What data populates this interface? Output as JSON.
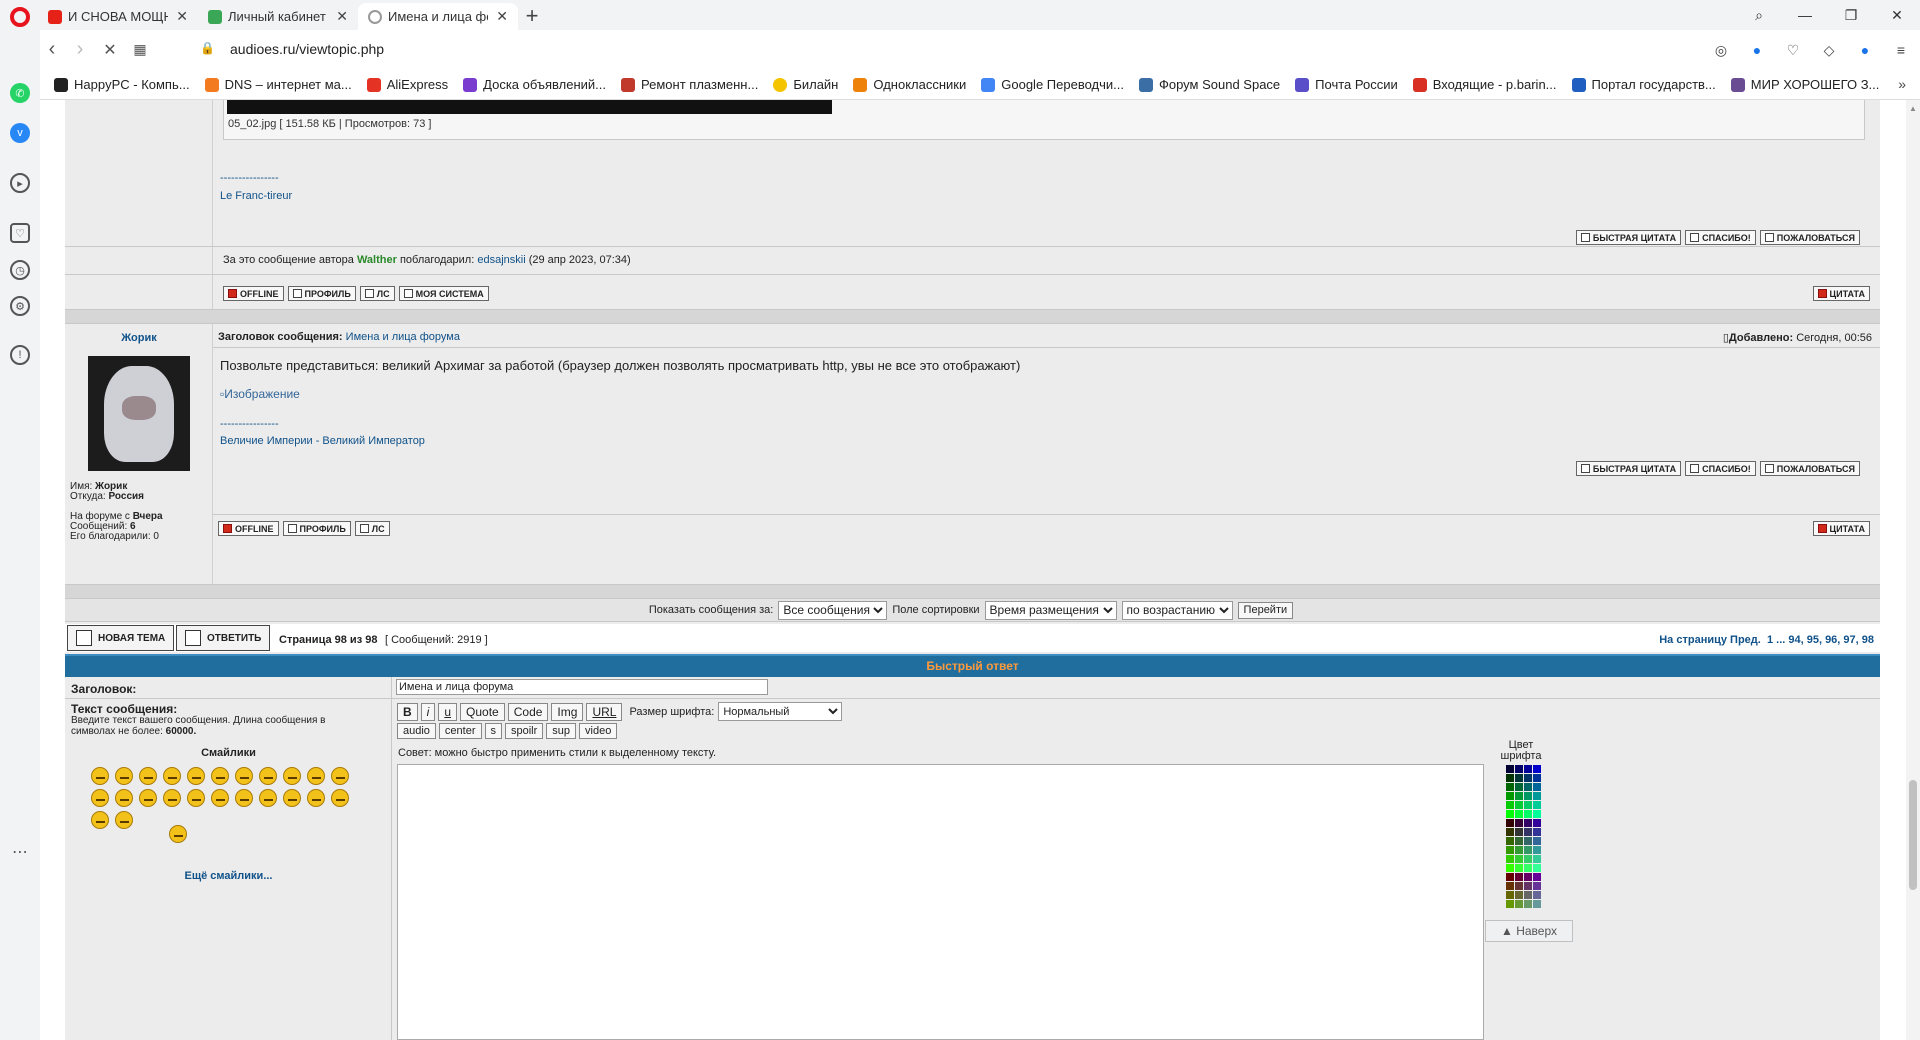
{
  "tabs": [
    {
      "label": "И СНОВА МОЩНЫЙ П...",
      "color": "#e62117"
    },
    {
      "label": "Личный кабинет - Мои о...",
      "color": "#3aa757"
    },
    {
      "label": "Имена и лица форума Фо...",
      "color": "#cfcfcf"
    }
  ],
  "address": {
    "url": "audioes.ru/viewtopic.php"
  },
  "bookmarks": [
    {
      "label": "HappyPC - Компь...",
      "color": "#222"
    },
    {
      "label": "DNS – интернет ма...",
      "color": "#f47a20"
    },
    {
      "label": "AliExpress",
      "color": "#e43225"
    },
    {
      "label": "Доска объявлений...",
      "color": "#7a3ccf"
    },
    {
      "label": "Ремонт плазменн...",
      "color": "#c0392b"
    },
    {
      "label": "Билайн",
      "color": "#f5c400"
    },
    {
      "label": "Одноклассники",
      "color": "#ee8208"
    },
    {
      "label": "Google Переводчи...",
      "color": "#4285f4"
    },
    {
      "label": "Форум Sound Space",
      "color": "#3a6ea5"
    },
    {
      "label": "Почта России",
      "color": "#5a4ec9"
    },
    {
      "label": "Входящие - p.barin...",
      "color": "#d93025"
    },
    {
      "label": "Портал государств...",
      "color": "#1f5fbf"
    },
    {
      "label": "МИР ХОРОШЕГО З...",
      "color": "#6a4c93"
    }
  ],
  "post1": {
    "attachment": "05_02.jpg [ 151.58 КБ | Просмотров: 73 ]",
    "sig_dashes": "----------------",
    "signature": "Le Franc-tireur",
    "thanks_prefix": "За это сообщение автора",
    "thanks_author": "Walther",
    "thanks_mid": "поблагодарил:",
    "thanks_user": "edsajnskii",
    "thanks_date": "(29 апр 2023, 07:34)"
  },
  "post2": {
    "author": "Жорик",
    "subject_label": "Заголовок сообщения:",
    "subject": "Имена и лица форума",
    "added_label": "Добавлено:",
    "added": "Сегодня, 00:56",
    "text": "Позвольте представиться: великий Архимаг за работой (браузер должен позволять просматривать http, увы не все это отображают)",
    "image_alt": "Изображение",
    "sig_dashes": "----------------",
    "signature": "Величие Империи - Великий Император",
    "profile": {
      "name_label": "Имя:",
      "name": "Жорик",
      "from_label": "Откуда:",
      "from": "Россия",
      "since_label": "На форуме с",
      "since": "Вчера",
      "posts_label": "Сообщений:",
      "posts": "6",
      "thanked_label": "Его благодарили:",
      "thanked": "0"
    }
  },
  "buttons": {
    "quick_quote": "БЫСТРАЯ ЦИТАТА",
    "thanks": "СПАСИБО!",
    "report": "ПОЖАЛОВАТЬСЯ",
    "offline": "OFFLINE",
    "profile": "ПРОФИЛЬ",
    "pm": "ЛС",
    "system": "МОЯ СИСТЕМА",
    "quote": "ЦИТАТА",
    "new_topic": "НОВАЯ ТЕМА",
    "reply": "ОТВЕТИТЬ"
  },
  "sortbar": {
    "show_label": "Показать сообщения за:",
    "show_value": "Все сообщения",
    "sort_label": "Поле сортировки",
    "sort_value": "Время размещения",
    "order_value": "по возрастанию",
    "go": "Перейти"
  },
  "pagination": {
    "page_info": "Страница 98 из 98",
    "count": "[ Сообщений: 2919 ]",
    "nav_label": "На страницу",
    "prev": "Пред.",
    "pages": "1 ... 94, 95, 96, 97, 98"
  },
  "quick_reply": {
    "title": "Быстрый ответ",
    "subject_label": "Заголовок:",
    "subject_value": "Имена и лица форума",
    "message_label": "Текст сообщения:",
    "message_hint": "Введите текст вашего сообщения. Длина сообщения в символах не более:",
    "message_max": "60000.",
    "smilies_title": "Смайлики",
    "more_smilies": "Ещё смайлики...",
    "font_size_label": "Размер шрифта:",
    "font_size_value": "Нормальный",
    "tip": "Совет: можно быстро применить стили к выделенному тексту.",
    "font_color_label": "Цвет шрифта",
    "bbcodes_row1": [
      "B",
      "i",
      "u",
      "Quote",
      "Code",
      "Img",
      "URL"
    ],
    "bbcodes_row2": [
      "audio",
      "center",
      "s",
      "spoilr",
      "sup",
      "video"
    ]
  },
  "back_to_top": "▲ Наверх",
  "colors": {
    "header_bar": "#1f6e9e",
    "header_text": "#ff9a3c",
    "link": "#105289",
    "forum_bg": "#ececec"
  }
}
